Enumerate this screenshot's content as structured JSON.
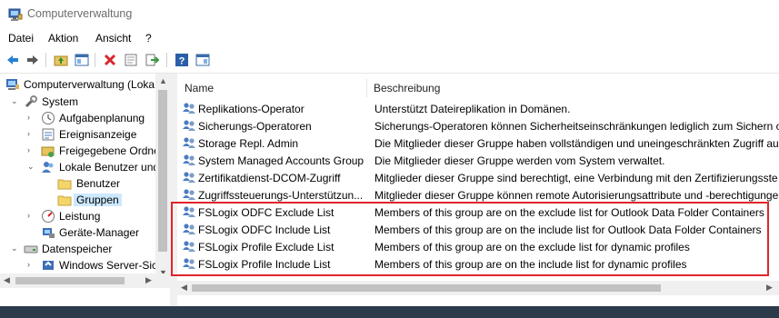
{
  "window": {
    "title": "Computerverwaltung"
  },
  "menu": [
    "Datei",
    "Aktion",
    "Ansicht",
    "?"
  ],
  "toolbar": [
    "back-icon",
    "forward-icon",
    "up-folder-icon",
    "show-hide-tree-icon",
    "delete-icon",
    "properties-icon",
    "export-icon",
    "help-icon",
    "action-pane-icon"
  ],
  "tree": [
    {
      "label": "Computerverwaltung (Loka",
      "icon": "computer-icon",
      "expander": "",
      "indent": 0
    },
    {
      "label": "System",
      "icon": "tools-icon",
      "expander": "v",
      "indent": 1
    },
    {
      "label": "Aufgabenplanung",
      "icon": "clock-icon",
      "expander": ">",
      "indent": 2
    },
    {
      "label": "Ereignisanzeige",
      "icon": "event-viewer-icon",
      "expander": ">",
      "indent": 2
    },
    {
      "label": "Freigegebene Ordne",
      "icon": "shared-folder-icon",
      "expander": ">",
      "indent": 2
    },
    {
      "label": "Lokale Benutzer und",
      "icon": "users-icon",
      "expander": "v",
      "indent": 2
    },
    {
      "label": "Benutzer",
      "icon": "folder-icon",
      "expander": "",
      "indent": 3
    },
    {
      "label": "Gruppen",
      "icon": "folder-icon",
      "expander": "",
      "indent": 3,
      "selected": true
    },
    {
      "label": "Leistung",
      "icon": "performance-icon",
      "expander": ">",
      "indent": 2
    },
    {
      "label": "Geräte-Manager",
      "icon": "device-manager-icon",
      "expander": "",
      "indent": 2
    },
    {
      "label": "Datenspeicher",
      "icon": "storage-icon",
      "expander": "v",
      "indent": 1
    },
    {
      "label": "Windows Server-Sich",
      "icon": "backup-icon",
      "expander": ">",
      "indent": 2
    }
  ],
  "list": {
    "columns": [
      "Name",
      "Beschreibung"
    ],
    "rows": [
      {
        "name": "Replikations-Operator",
        "desc": "Unterstützt Dateireplikation in Domänen."
      },
      {
        "name": "Sicherungs-Operatoren",
        "desc": "Sicherungs-Operatoren können Sicherheitseinschränkungen lediglich zum Sichern o"
      },
      {
        "name": "Storage Repl. Admin",
        "desc": "Die Mitglieder dieser Gruppe haben vollständigen und uneingeschränkten Zugriff au"
      },
      {
        "name": "System Managed Accounts Group",
        "desc": "Die Mitglieder dieser Gruppe werden vom System verwaltet."
      },
      {
        "name": "Zertifikatdienst-DCOM-Zugriff",
        "desc": "Mitglieder dieser Gruppe sind berechtigt, eine Verbindung mit den Zertifizierungsste"
      },
      {
        "name": "Zugriffssteuerungs-Unterstützun...",
        "desc": "Mitglieder dieser Gruppe können remote Autorisierungsattribute und -berechtigunge"
      },
      {
        "name": "FSLogix ODFC Exclude List",
        "desc": "Members of this group are on the exclude list for Outlook Data Folder Containers"
      },
      {
        "name": "FSLogix ODFC Include List",
        "desc": "Members of this group are on the include list for Outlook Data Folder Containers"
      },
      {
        "name": "FSLogix Profile Exclude List",
        "desc": "Members of this group are on the exclude list for dynamic profiles"
      },
      {
        "name": "FSLogix Profile Include List",
        "desc": "Members of this group are on the include list for dynamic profiles"
      }
    ]
  },
  "colors": {
    "highlight": "#e0242c",
    "selection": "#cce8ff"
  }
}
